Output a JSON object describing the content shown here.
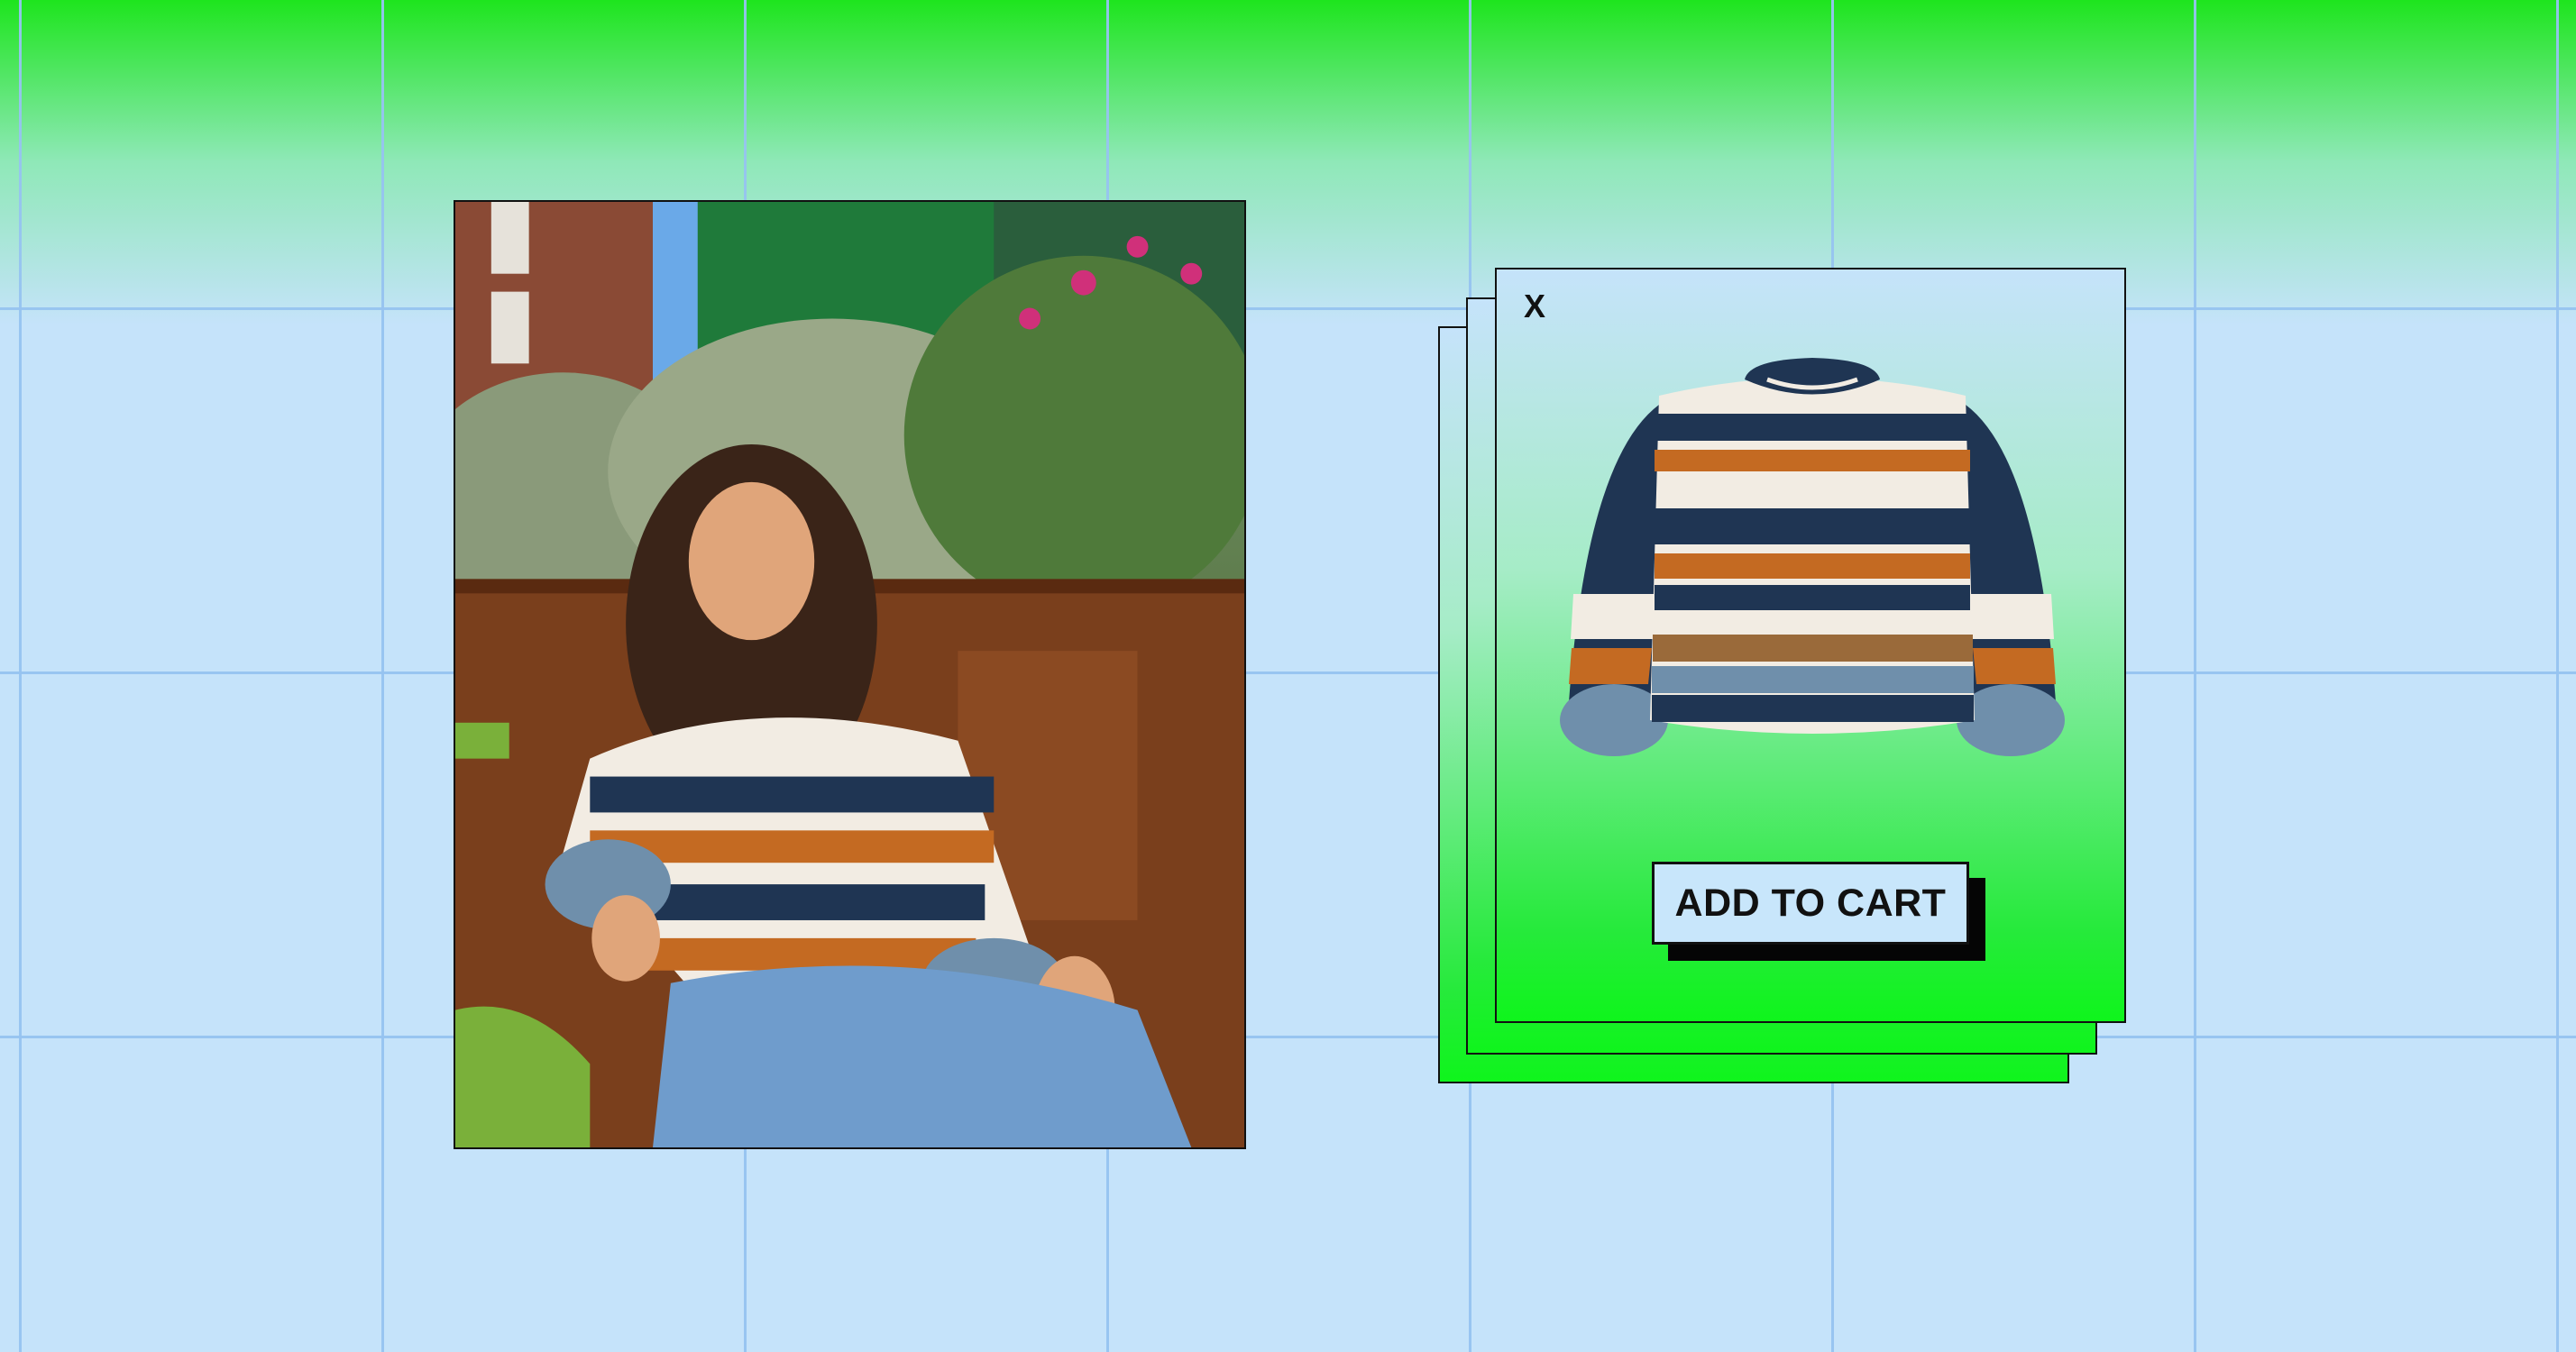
{
  "colors": {
    "background": "#c5e3fa",
    "grid_line": "#96c3f0",
    "accent_green": "#0ff51c",
    "ink": "#111111"
  },
  "photo": {
    "subject": "woman-wearing-striped-sweater"
  },
  "product_card": {
    "close_label": "X",
    "image": "striped-knit-sweater",
    "add_to_cart_label": "ADD TO CART"
  }
}
